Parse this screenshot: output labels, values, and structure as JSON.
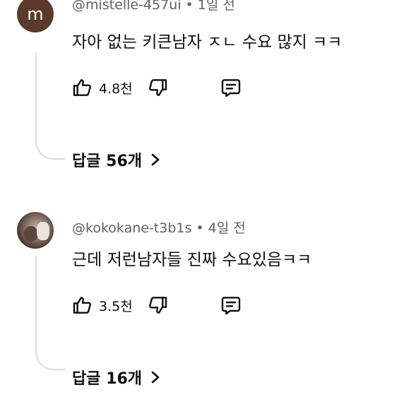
{
  "comments": [
    {
      "avatar_letter": "m",
      "handle": "@mistelle-457ui",
      "time": "1일 전",
      "text": "자아 없는 키큰남자 ㅈㄴ 수요 많지 ㅋㅋ",
      "likes": "4.8천",
      "replies_label": "답글 56개"
    },
    {
      "avatar_letter": "",
      "handle": "@kokokane-t3b1s",
      "time": "4일 전",
      "text": "근데 저런남자들 진짜 수요있음ㅋㅋ",
      "likes": "3.5천",
      "replies_label": "답글 16개"
    }
  ],
  "separator": "•",
  "icons": {
    "like": "thumbs-up-icon",
    "dislike": "thumbs-down-icon",
    "reply": "comment-icon",
    "expand": "chevron-right-icon"
  },
  "colors": {
    "text": "#0f0f0f",
    "secondary": "#606060",
    "thread_line": "#dcdcdc",
    "avatar_brown": "#5b3a29"
  }
}
